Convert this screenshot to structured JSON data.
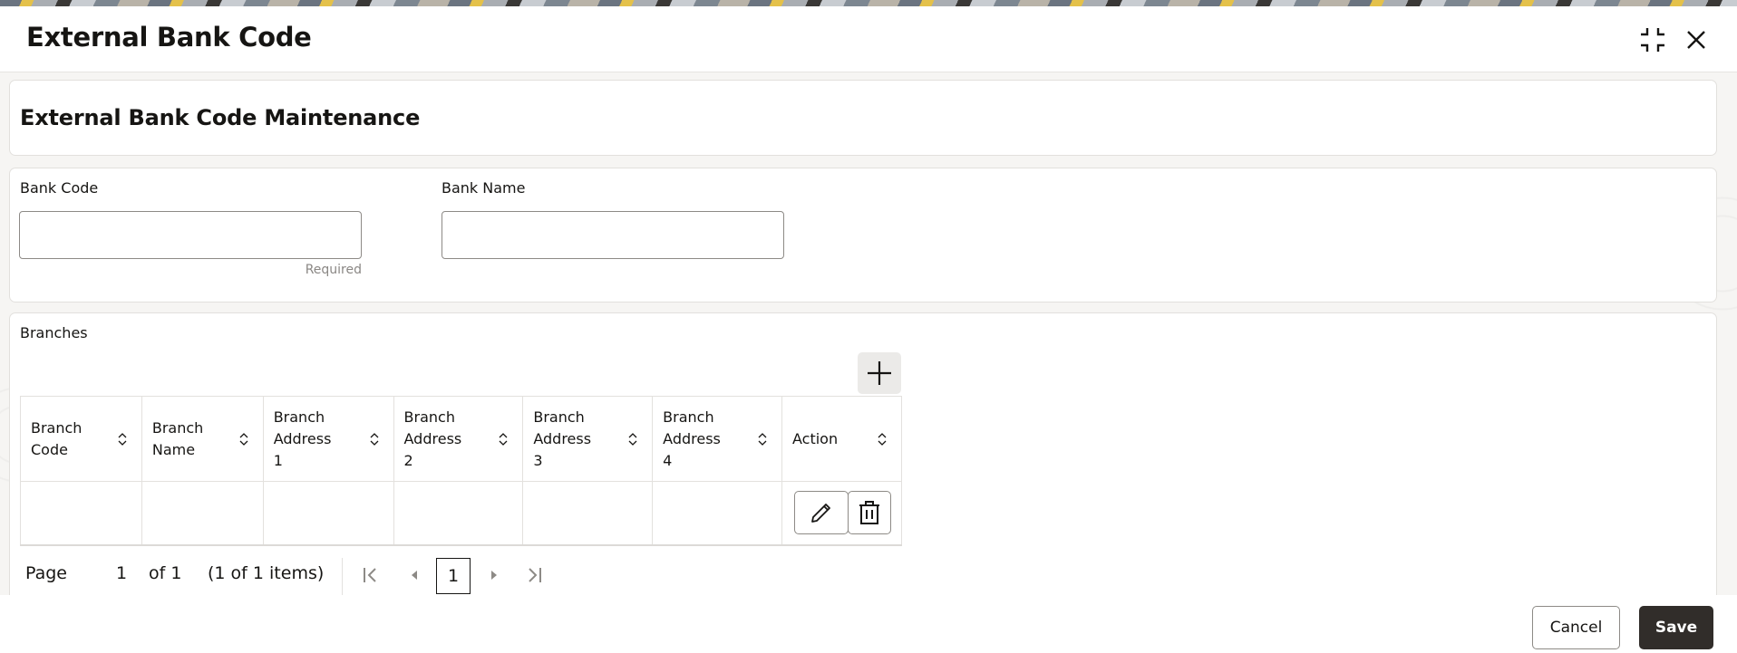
{
  "dialog": {
    "title": "External Bank Code",
    "compress_icon": "compress-icon",
    "close_icon": "close-icon"
  },
  "maintenance": {
    "title": "External Bank Code Maintenance"
  },
  "form": {
    "bank_code": {
      "label": "Bank Code",
      "value": "",
      "placeholder": "",
      "help": "Required"
    },
    "bank_name": {
      "label": "Bank Name",
      "value": "",
      "placeholder": ""
    }
  },
  "branches": {
    "label": "Branches",
    "add_icon": "plus-icon",
    "columns": [
      {
        "label": "Branch Code"
      },
      {
        "label": "Branch Name"
      },
      {
        "label": "Branch Address 1"
      },
      {
        "label": "Branch Address 2"
      },
      {
        "label": "Branch Address 3"
      },
      {
        "label": "Branch Address 4"
      },
      {
        "label": "Action"
      }
    ],
    "rows": [
      {
        "branch_code": "",
        "branch_name": "",
        "address1": "",
        "address2": "",
        "address3": "",
        "address4": ""
      }
    ],
    "row_actions": [
      "edit-icon",
      "trash-icon"
    ]
  },
  "pagination": {
    "page_label": "Page",
    "page_value": "1",
    "of_label": "of 1",
    "items_label": "(1 of 1 items)",
    "current_page": "1"
  },
  "footer": {
    "cancel_label": "Cancel",
    "save_label": "Save"
  },
  "colors": {
    "primary_button": "#312d2a",
    "border": "#8d8a86",
    "text": "#161513"
  }
}
